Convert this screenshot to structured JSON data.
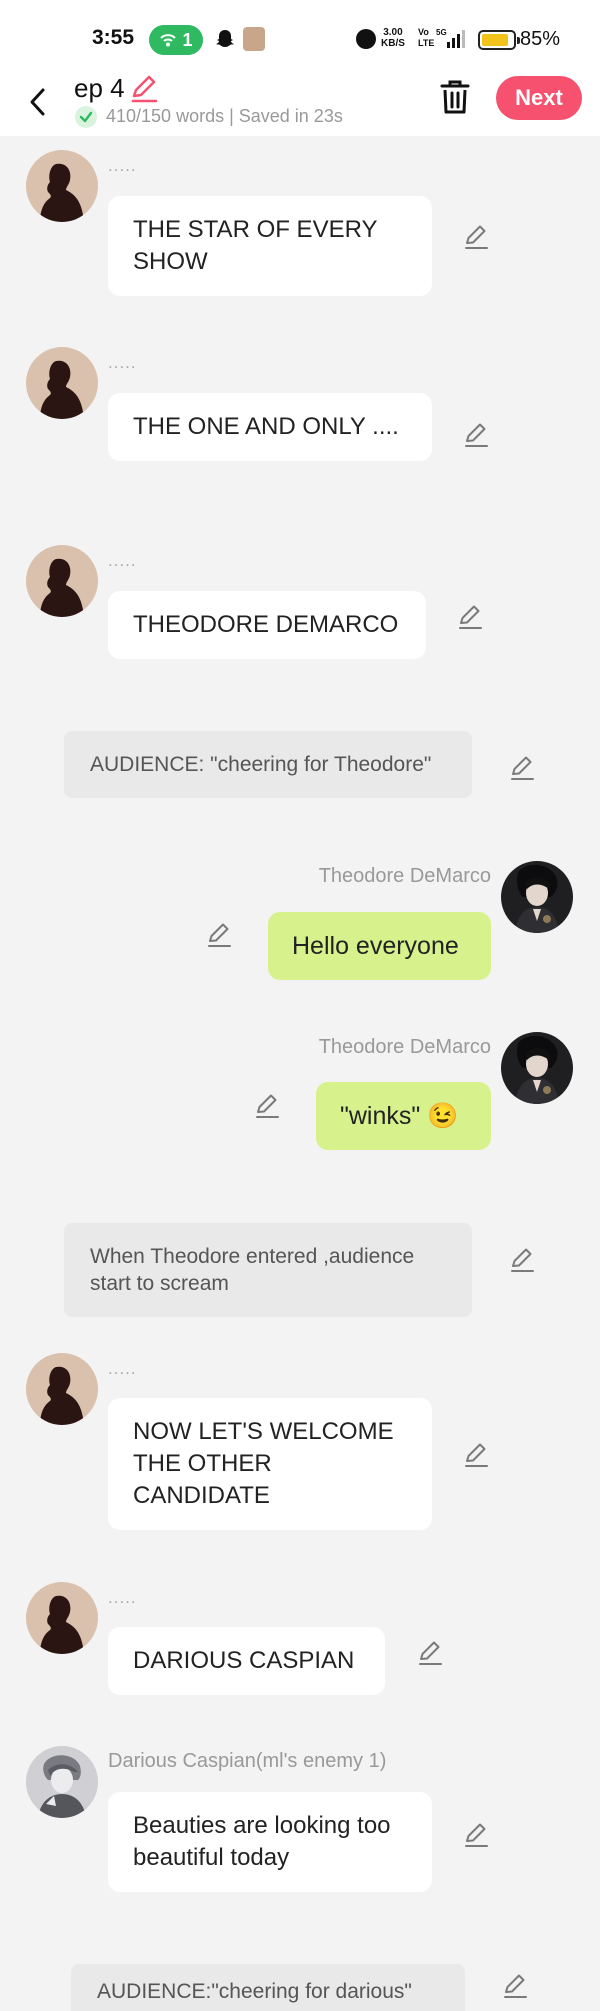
{
  "status_bar": {
    "time": "3:55",
    "hotspot_count": "1",
    "net_speed_top": "3.00",
    "net_speed_unit": "KB/S",
    "volte_top": "Vo",
    "volte_bottom": "LTE",
    "signal_label": "5G",
    "battery_percent": "85%",
    "battery_level": 0.85
  },
  "header": {
    "title": "ep 4",
    "word_info": "410/150 words | Saved in 23s",
    "next_label": "Next",
    "accent_color": "#f6516f"
  },
  "chat": {
    "narrator_dots": ".....",
    "messages": [
      {
        "kind": "narrator",
        "text": "THE STAR OF EVERY SHOW"
      },
      {
        "kind": "narrator",
        "text": "THE ONE AND ONLY ...."
      },
      {
        "kind": "narrator",
        "text": "THEODORE DEMARCO"
      },
      {
        "kind": "system",
        "text": "AUDIENCE: \"cheering for Theodore\""
      },
      {
        "kind": "right",
        "name": "Theodore DeMarco",
        "text": "Hello everyone"
      },
      {
        "kind": "right",
        "name": "Theodore DeMarco",
        "text": "\"winks\" 😉"
      },
      {
        "kind": "system",
        "text": "When Theodore entered ,audience start to scream"
      },
      {
        "kind": "narrator",
        "text": "NOW LET'S WELCOME THE OTHER CANDIDATE"
      },
      {
        "kind": "narrator",
        "text": "DARIOUS CASPIAN"
      },
      {
        "kind": "left",
        "name": "Darious Caspian(ml's enemy 1)",
        "text": "Beauties are looking too beautiful today"
      },
      {
        "kind": "system",
        "text": "AUDIENCE:\"cheering for darious\""
      }
    ]
  }
}
